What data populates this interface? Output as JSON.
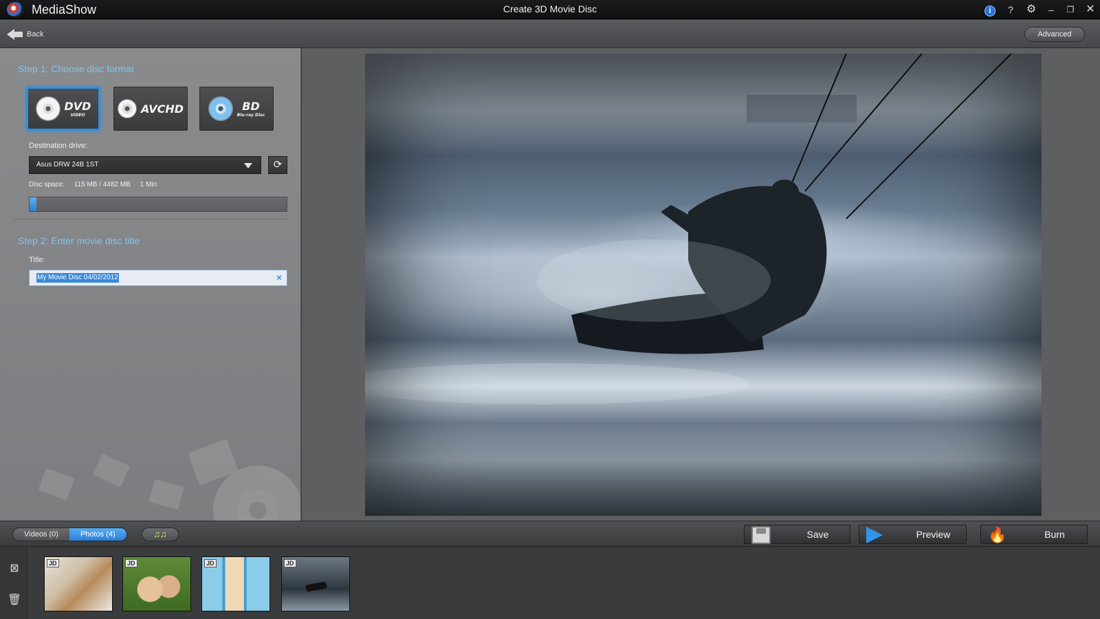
{
  "titlebar": {
    "app_name": "MediaShow",
    "window_title": "Create 3D Movie Disc",
    "info_icon": "i",
    "help_icon": "?",
    "settings_icon": "⚙",
    "minimize_icon": "–",
    "maximize_icon": "❐",
    "close_icon": "✕"
  },
  "nav": {
    "back_label": "Back",
    "advanced_label": "Advanced"
  },
  "step1": {
    "title": "Step 1: Choose disc format",
    "formats": [
      {
        "name": "DVD Video",
        "logo": "DVD",
        "sub": "VIDEO",
        "selected": true
      },
      {
        "name": "AVCHD",
        "logo": "AVCHD",
        "selected": false
      },
      {
        "name": "Blu-ray Disc",
        "logo": "BD",
        "sub": "Blu-ray Disc",
        "selected": false
      }
    ],
    "destination_label": "Destination drive:",
    "destination_value": "Asus DRW 24B 1ST",
    "disc_space_label": "Disc space:",
    "disc_space_value": "115 MB  /  4482 MB",
    "disc_time": "1 Min",
    "disc_space_fraction": 0.0257
  },
  "step2": {
    "title": "Step 2: Enter movie disc title",
    "title_label": "Title:",
    "title_value": "My Movie Disc 04/02/2012"
  },
  "toolbar": {
    "tab_videos": "Videos (0)",
    "tab_photos": "Photos (4)",
    "music_icon": "♫♫",
    "save_label": "Save",
    "preview_label": "Preview",
    "burn_label": "Burn"
  },
  "storyboard": {
    "thumb_tag": "JD",
    "photos": [
      "photo-1",
      "photo-2",
      "photo-3",
      "photo-4"
    ]
  },
  "colors": {
    "accent": "#2e8fe0",
    "step_title": "#7fc3ee"
  }
}
